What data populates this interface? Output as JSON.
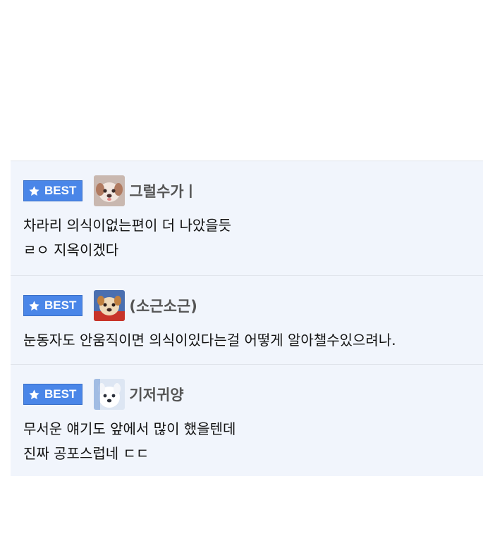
{
  "badge_label": "BEST",
  "colors": {
    "badge": "#4a86e8",
    "panel": "#f1f5fc",
    "divider": "#dfe3ea",
    "nick": "#555555"
  },
  "comments": [
    {
      "nickname": "그럴수가ㅣ",
      "avatar": "puppy-avatar",
      "lines": [
        "차라리 의식이없는편이 더 나았을듯",
        "ㄹㅇ 지옥이겠다"
      ]
    },
    {
      "nickname": "(소근소근)",
      "avatar": "puppy-avatar",
      "lines": [
        "눈동자도 안움직이면 의식이있다는걸 어떻게 알아챌수있으려나."
      ]
    },
    {
      "nickname": "기저귀양",
      "avatar": "white-dog-avatar",
      "lines": [
        "무서운 얘기도 앞에서 많이 했을텐데",
        "진짜 공포스럽네 ㄷㄷ"
      ]
    }
  ]
}
